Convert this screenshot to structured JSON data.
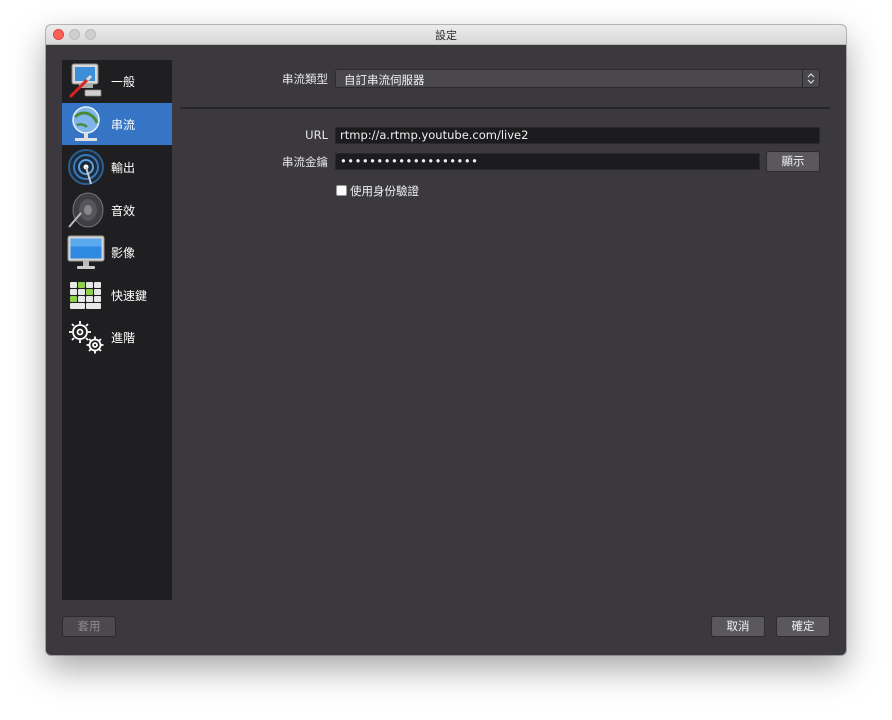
{
  "window": {
    "title": "設定"
  },
  "sidebar": {
    "items": [
      {
        "label": "一般",
        "icon": "general-settings-icon",
        "active": false
      },
      {
        "label": "串流",
        "icon": "stream-network-icon",
        "active": true
      },
      {
        "label": "輸出",
        "icon": "output-broadcast-icon",
        "active": false
      },
      {
        "label": "音效",
        "icon": "audio-speaker-icon",
        "active": false
      },
      {
        "label": "影像",
        "icon": "video-monitor-icon",
        "active": false
      },
      {
        "label": "快速鍵",
        "icon": "keyboard-hotkeys-icon",
        "active": false
      },
      {
        "label": "進階",
        "icon": "advanced-gears-icon",
        "active": false
      }
    ]
  },
  "stream": {
    "type_label": "串流類型",
    "type_value": "自訂串流伺服器",
    "url_label": "URL",
    "url_value": "rtmp://a.rtmp.youtube.com/live2",
    "key_label": "串流金鑰",
    "key_value": "•••••••••••••••••••",
    "show_button": "顯示",
    "auth_checkbox_label": "使用身份驗證",
    "auth_checked": false
  },
  "footer": {
    "apply_label": "套用",
    "cancel_label": "取消",
    "ok_label": "確定"
  },
  "colors": {
    "accent": "#3675c6",
    "window_bg": "#3b393d",
    "sidebar_bg": "#1f1e21",
    "close_button": "#fd5f57"
  }
}
